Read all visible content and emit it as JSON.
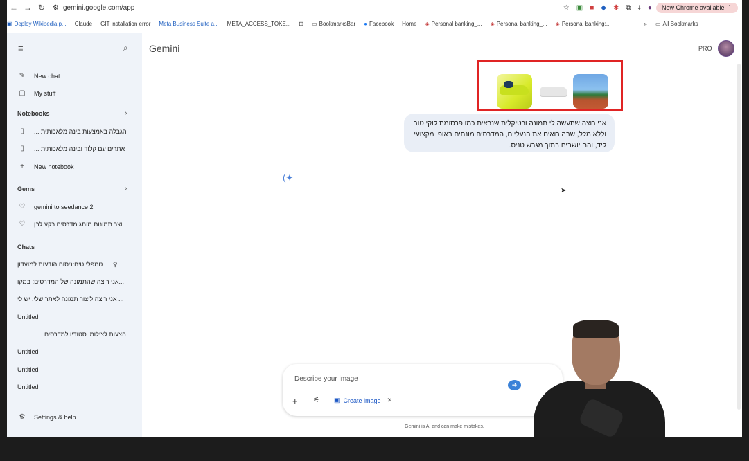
{
  "browser": {
    "url": "gemini.google.com/app",
    "new_chrome": "New Chrome available"
  },
  "bookmarks": [
    {
      "label": "Deploy Wikipedia p..."
    },
    {
      "label": "Claude"
    },
    {
      "label": "GIT installation error"
    },
    {
      "label": "Meta Business Suite a..."
    },
    {
      "label": "META_ACCESS_TOKE..."
    },
    {
      "label": "BookmarksBar"
    },
    {
      "label": "Facebook"
    },
    {
      "label": "Home"
    },
    {
      "label": "Personal banking_..."
    },
    {
      "label": "Personal banking_..."
    },
    {
      "label": "Personal banking:..."
    },
    {
      "label": "All Bookmarks"
    }
  ],
  "sidebar": {
    "new_chat": "New chat",
    "my_stuff": "My stuff",
    "notebooks_heading": "Notebooks",
    "notebooks": [
      "הגבלה באמצעות בינה מלאכותית ...",
      "אתרים עם קלוד ובינה מלאכותית ..."
    ],
    "new_notebook": "New notebook",
    "gems_heading": "Gems",
    "gems": [
      "gemini to seedance 2",
      "יוצר תמונות מותג מדרסים רקע לבן"
    ],
    "chats_heading": "Chats",
    "chats": [
      "טמפלייטים:ניסוח הודעות למועדון",
      "אני רוצה שהתמונה של המדרסים: במקו...",
      "אני רוצה ליצור תמונה לאתר שלי. יש לי ...",
      "Untitled",
      "הצעות לצילומי סטודיו למדרסים",
      "Untitled",
      "Untitled",
      "Untitled"
    ],
    "settings": "Settings & help"
  },
  "main": {
    "title": "Gemini",
    "pro": "PRO",
    "message": "אני רוצה שתעשה לי תמונה ורטיקלית שנראית כמו פרסומת לוקי טוב וללא מלל, שבה רואים את הנעליים, המדרסים מונחים באופן מקצועי ליד, והם יושבים בתוך מגרש טניס.",
    "input_placeholder": "Describe your image",
    "chip_label": "Create image",
    "disclaimer": "Gemini is AI and can make mistakes."
  },
  "colors": {
    "accent": "#3b82d8",
    "highlight_box": "#e02424",
    "sidebar_bg": "#eff3f9"
  }
}
